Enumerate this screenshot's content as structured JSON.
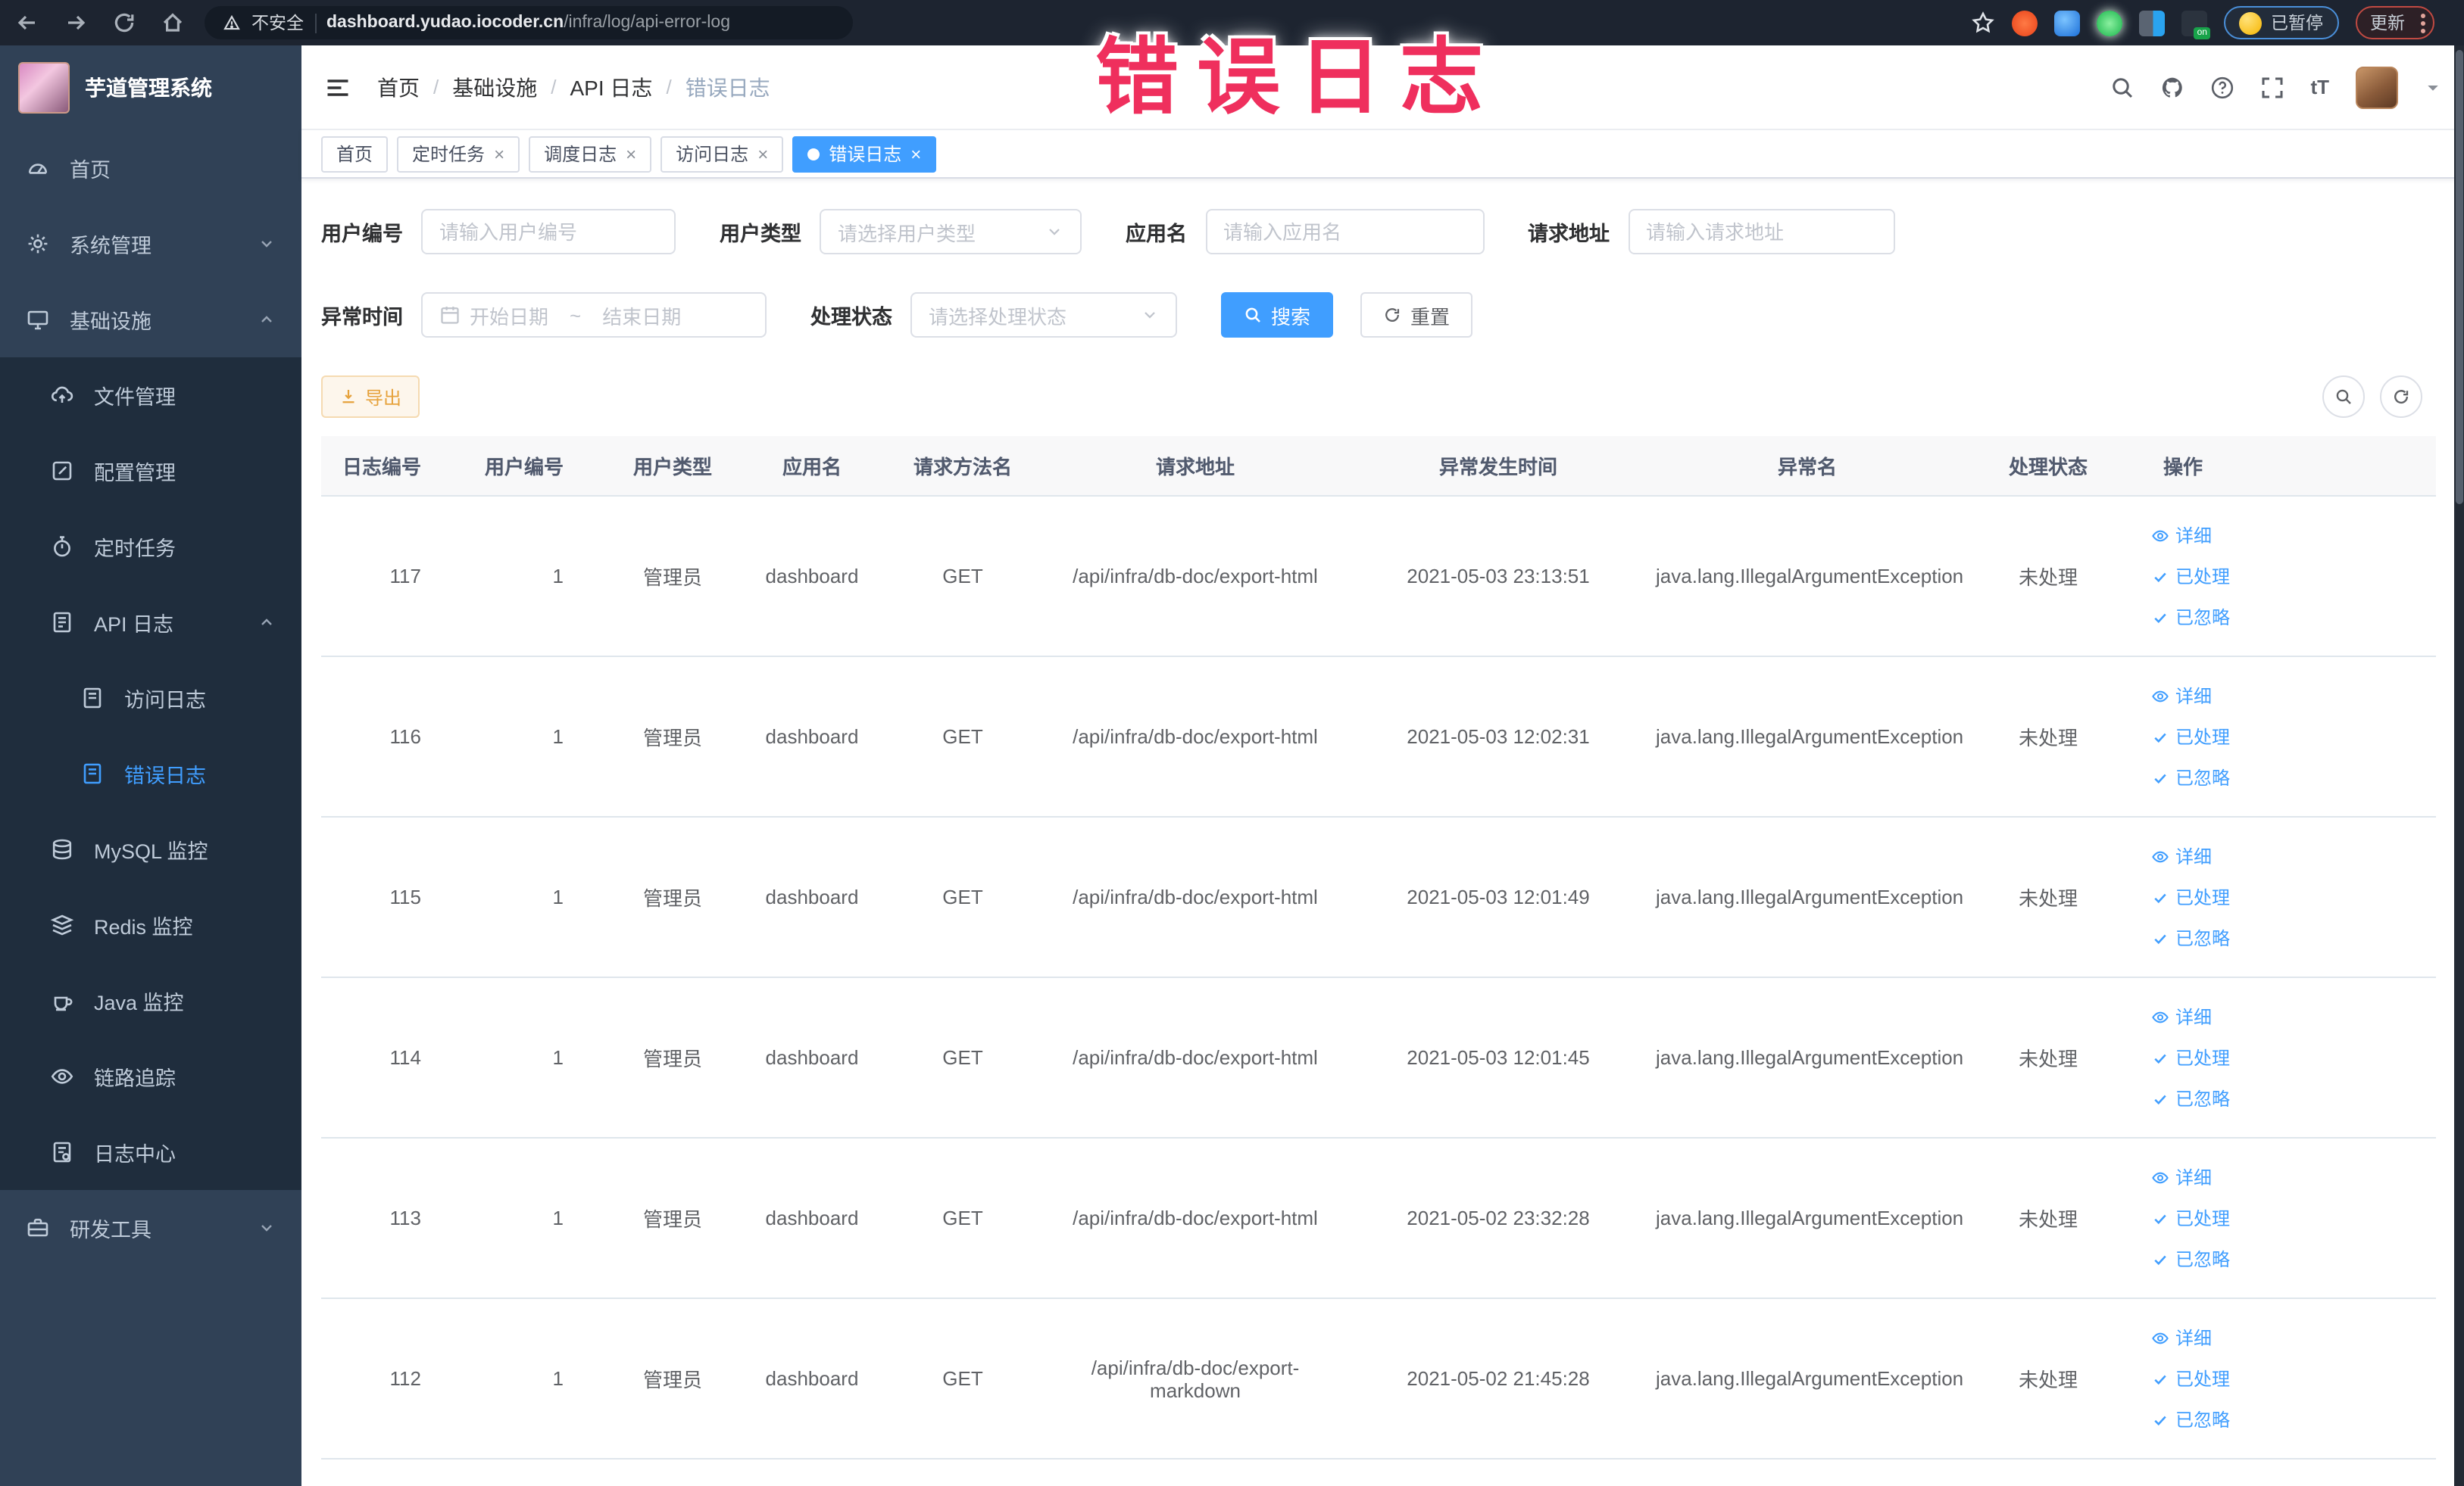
{
  "colors": {
    "accent": "#409EFF",
    "warning": "#e6a23c",
    "annotation_red": "#ef2f5d",
    "sidebar_bg": "#304156",
    "submenu_bg": "#1f2d3d"
  },
  "browser": {
    "security_label": "不安全",
    "url_host": "dashboard.yudao.iocoder.cn",
    "url_path": "/infra/log/api-error-log",
    "paused_label": "已暂停",
    "update_label": "更新",
    "extension_on_badge": "on"
  },
  "annotation": {
    "text": "错误日志"
  },
  "sidebar": {
    "title": "芋道管理系统",
    "items": [
      {
        "label": "首页"
      },
      {
        "label": "系统管理"
      },
      {
        "label": "基础设施"
      },
      {
        "label": "文件管理"
      },
      {
        "label": "配置管理"
      },
      {
        "label": "定时任务"
      },
      {
        "label": "API 日志"
      },
      {
        "label": "访问日志"
      },
      {
        "label": "错误日志"
      },
      {
        "label": "MySQL 监控"
      },
      {
        "label": "Redis 监控"
      },
      {
        "label": "Java 监控"
      },
      {
        "label": "链路追踪"
      },
      {
        "label": "日志中心"
      },
      {
        "label": "研发工具"
      }
    ]
  },
  "header": {
    "breadcrumb": [
      "首页",
      "基础设施",
      "API 日志",
      "错误日志"
    ],
    "separator": "/"
  },
  "tabs": {
    "items": [
      {
        "label": "首页"
      },
      {
        "label": "定时任务"
      },
      {
        "label": "调度日志"
      },
      {
        "label": "访问日志"
      },
      {
        "label": "错误日志"
      }
    ]
  },
  "filters": {
    "user_id": {
      "label": "用户编号",
      "placeholder": "请输入用户编号"
    },
    "user_type": {
      "label": "用户类型",
      "placeholder": "请选择用户类型"
    },
    "app_name": {
      "label": "应用名",
      "placeholder": "请输入应用名"
    },
    "request_url": {
      "label": "请求地址",
      "placeholder": "请输入请求地址"
    },
    "exception_time": {
      "label": "异常时间",
      "start_placeholder": "开始日期",
      "separator": "~",
      "end_placeholder": "结束日期"
    },
    "process_status": {
      "label": "处理状态",
      "placeholder": "请选择处理状态"
    },
    "search_label": "搜索",
    "reset_label": "重置"
  },
  "toolbar": {
    "export_label": "导出"
  },
  "table": {
    "columns": [
      "日志编号",
      "用户编号",
      "用户类型",
      "应用名",
      "请求方法名",
      "请求地址",
      "异常发生时间",
      "异常名",
      "处理状态",
      "操作"
    ],
    "actions": [
      "详细",
      "已处理",
      "已忽略"
    ],
    "rows": [
      {
        "id": "117",
        "uid": "1",
        "utype": "管理员",
        "app": "dashboard",
        "method": "GET",
        "url": "/api/infra/db-doc/export-html",
        "time": "2021-05-03 23:13:51",
        "exc": "java.lang.IllegalArgumentException",
        "status": "未处理"
      },
      {
        "id": "116",
        "uid": "1",
        "utype": "管理员",
        "app": "dashboard",
        "method": "GET",
        "url": "/api/infra/db-doc/export-html",
        "time": "2021-05-03 12:02:31",
        "exc": "java.lang.IllegalArgumentException",
        "status": "未处理"
      },
      {
        "id": "115",
        "uid": "1",
        "utype": "管理员",
        "app": "dashboard",
        "method": "GET",
        "url": "/api/infra/db-doc/export-html",
        "time": "2021-05-03 12:01:49",
        "exc": "java.lang.IllegalArgumentException",
        "status": "未处理"
      },
      {
        "id": "114",
        "uid": "1",
        "utype": "管理员",
        "app": "dashboard",
        "method": "GET",
        "url": "/api/infra/db-doc/export-html",
        "time": "2021-05-03 12:01:45",
        "exc": "java.lang.IllegalArgumentException",
        "status": "未处理"
      },
      {
        "id": "113",
        "uid": "1",
        "utype": "管理员",
        "app": "dashboard",
        "method": "GET",
        "url": "/api/infra/db-doc/export-html",
        "time": "2021-05-02 23:32:28",
        "exc": "java.lang.IllegalArgumentException",
        "status": "未处理"
      },
      {
        "id": "112",
        "uid": "1",
        "utype": "管理员",
        "app": "dashboard",
        "method": "GET",
        "url": "/api/infra/db-doc/export-markdown",
        "time": "2021-05-02 21:45:28",
        "exc": "java.lang.IllegalArgumentException",
        "status": "未处理"
      }
    ]
  }
}
